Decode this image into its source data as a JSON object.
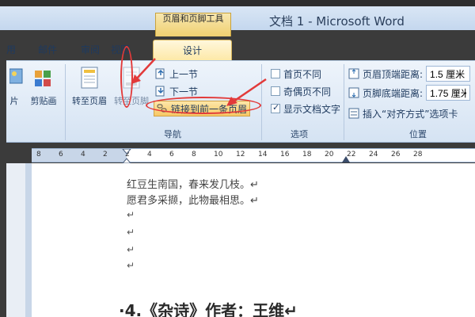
{
  "window": {
    "context_group": "页眉和页脚工具",
    "title": "文档 1 - Microsoft Word"
  },
  "tabs": {
    "partial_left": "用",
    "mail": "邮件",
    "review": "审阅",
    "view": "视图",
    "design": "设计"
  },
  "ribbon": {
    "left_partial_label": "片",
    "clip_art": "剪贴画",
    "goto_header": "转至页眉",
    "goto_footer": "转至页脚",
    "prev_section": "上一节",
    "next_section": "下一节",
    "link_prev": "链接到前一条页眉",
    "group_nav": "导航",
    "opt_first_page": "首页不同",
    "opt_odd_even": "奇偶页不同",
    "opt_show_text": "显示文档文字",
    "group_options": "选项",
    "header_top_dist_label": "页眉顶端距离:",
    "header_top_dist_value": "1.5 厘米",
    "footer_bottom_dist_label": "页脚底端距离:",
    "footer_bottom_dist_value": "1.75 厘米",
    "insert_align_tab": "插入“对齐方式”选项卡",
    "group_position": "位置"
  },
  "options_state": {
    "first_page_checked": false,
    "odd_even_checked": false,
    "show_text_checked": true
  },
  "ruler": {
    "labels": [
      "8",
      "6",
      "4",
      "2",
      "2",
      "4",
      "6",
      "8",
      "10",
      "12",
      "14",
      "16",
      "18",
      "20",
      "22",
      "24",
      "26",
      "28"
    ]
  },
  "document": {
    "line1": "红豆生南国，春来发几枝。↵",
    "line2": "愿君多采撷，此物最相思。↵",
    "empty_mark": "↵",
    "heading": "·4.《杂诗》作者：王维↵"
  },
  "colors": {
    "annotation": "#e23a3a",
    "context_tab": "#f0d070",
    "ribbon_bg": "#dde8f5"
  }
}
